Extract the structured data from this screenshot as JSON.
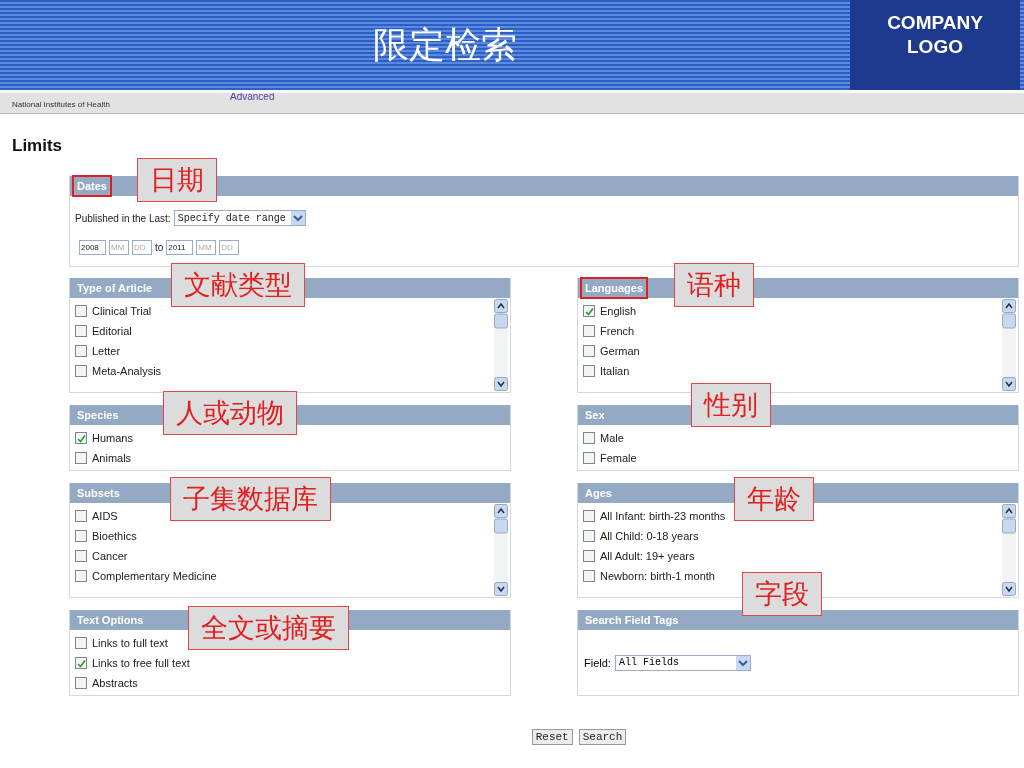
{
  "header": {
    "title": "限定检索",
    "logo": [
      "COMPANY",
      "LOGO"
    ]
  },
  "site_bar": {
    "agency": "National Institutes of Health",
    "link": "Advanced"
  },
  "page_title": "Limits",
  "dates": {
    "title": "Dates",
    "highlighted": true,
    "callout": "日期",
    "published_label": "Published in the Last:",
    "range": "Specify date range",
    "from": {
      "year": "2008",
      "month_placeholder": "MM",
      "day_placeholder": "DD"
    },
    "to_label": "to",
    "to": {
      "year": "2011",
      "month_placeholder": "MM",
      "day_placeholder": "DD"
    }
  },
  "left_column": [
    {
      "kind": "checklist",
      "title": "Type of Article",
      "highlighted": false,
      "callout": "文献类型",
      "scrollable": true,
      "items": [
        {
          "label": "Clinical Trial",
          "checked": false
        },
        {
          "label": "Editorial",
          "checked": false
        },
        {
          "label": "Letter",
          "checked": false
        },
        {
          "label": "Meta-Analysis",
          "checked": false
        }
      ]
    },
    {
      "kind": "checklist",
      "title": "Species",
      "highlighted": false,
      "callout": "人或动物",
      "scrollable": false,
      "items": [
        {
          "label": "Humans",
          "checked": true
        },
        {
          "label": "Animals",
          "checked": false
        }
      ]
    },
    {
      "kind": "checklist",
      "title": "Subsets",
      "highlighted": false,
      "callout": "子集数据库",
      "scrollable": true,
      "items": [
        {
          "label": "AIDS",
          "checked": false
        },
        {
          "label": "Bioethics",
          "checked": false
        },
        {
          "label": "Cancer",
          "checked": false
        },
        {
          "label": "Complementary Medicine",
          "checked": false
        }
      ]
    },
    {
      "kind": "checklist",
      "title": "Text Options",
      "highlighted": false,
      "callout": "全文或摘要",
      "scrollable": false,
      "items": [
        {
          "label": "Links to full text",
          "checked": false
        },
        {
          "label": "Links to free full text",
          "checked": true
        },
        {
          "label": "Abstracts",
          "checked": false
        }
      ]
    }
  ],
  "right_column": [
    {
      "kind": "checklist",
      "title": "Languages",
      "highlighted": true,
      "callout": "语种",
      "scrollable": true,
      "items": [
        {
          "label": "English",
          "checked": true
        },
        {
          "label": "French",
          "checked": false
        },
        {
          "label": "German",
          "checked": false
        },
        {
          "label": "Italian",
          "checked": false
        }
      ]
    },
    {
      "kind": "checklist",
      "title": "Sex",
      "highlighted": false,
      "callout": "性别",
      "scrollable": false,
      "items": [
        {
          "label": "Male",
          "checked": false
        },
        {
          "label": "Female",
          "checked": false
        }
      ]
    },
    {
      "kind": "checklist",
      "title": "Ages",
      "highlighted": false,
      "callout": "年龄",
      "scrollable": true,
      "items": [
        {
          "label": "All Infant: birth-23 months",
          "checked": false
        },
        {
          "label": "All Child: 0-18 years",
          "checked": false
        },
        {
          "label": "All Adult: 19+ years",
          "checked": false
        },
        {
          "label": "Newborn: birth-1 month",
          "checked": false
        }
      ]
    },
    {
      "kind": "field",
      "title": "Search Field Tags",
      "highlighted": false,
      "callout": "字段",
      "label": "Field:",
      "value": "All Fields"
    }
  ],
  "buttons": [
    "Reset",
    "Search"
  ]
}
